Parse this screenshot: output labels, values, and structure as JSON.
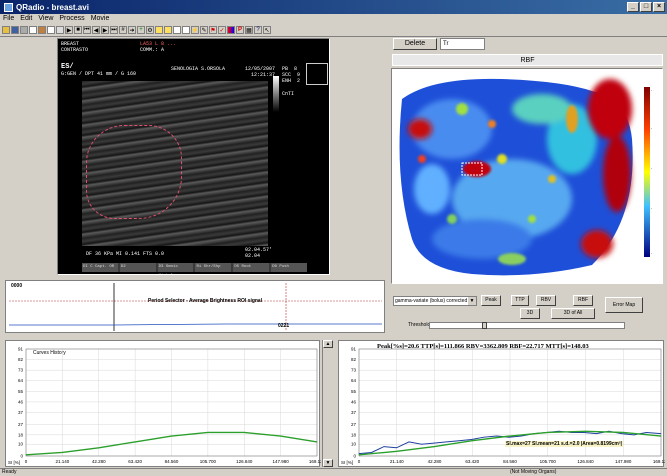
{
  "window": {
    "title": "QRadio - breast.avi"
  },
  "menu": [
    "File",
    "Edit",
    "View",
    "Process",
    "Movie"
  ],
  "ultrasound": {
    "top_left": [
      "BREAST",
      "CONTRASTO"
    ],
    "top_center": "LA53 L 8 ...",
    "comm": "COMM.: A",
    "es_label": "ES/",
    "gain_line": "G:GEN / DPT 41 mm / G 160",
    "hospital": "SENOLOGIA S.ORSOLA",
    "date": "12/05/2007",
    "time": "12:21:37",
    "params": [
      "PB  8",
      "SCC  9",
      "ENH  2"
    ],
    "cnti": "CnTI",
    "bottom_line": "DF 36 KPa MI 0.141 FTS 0.0",
    "timestamp": "02.04.57'",
    "frame": "02.04",
    "buttons": [
      "DI C Capt. OR",
      "D2",
      "D3 Omnic Histol.",
      "Ri Shr/Shp",
      "D5 Root",
      "D6 Push"
    ]
  },
  "rbf": {
    "delete_label": "Delete",
    "field_value": "Tr",
    "map_label": "RBF"
  },
  "period": {
    "counter_top": "0000",
    "title": "Period Selector - Average Brightness ROI signal",
    "counter_bottom": "0221"
  },
  "controls": {
    "method": "gamma-variate (bolus) corrected",
    "buttons": {
      "peak": "Peak",
      "ttp": "TTP",
      "rbv": "RBV",
      "rbf": "RBF",
      "d3": "3D",
      "d3all": "3D of All",
      "errmap": "Error Map"
    },
    "threshold": "Threshold",
    "threshold_fraction": 0.28
  },
  "left_chart": {
    "title": "Curves History"
  },
  "right_chart": {
    "title": "Peak[%s]=20.6  TTP[s]=111.866  RBV=3362.809  RBF=22.717  MTT[s]=148.03",
    "stats": "Sl.max=27  Sl.mean=21  s.d.=2.0  |Area=0.8199cm²|"
  },
  "chart_data": [
    {
      "type": "line",
      "title": "Curves History",
      "ylabel": "SI [%]",
      "ylim": [
        0,
        91
      ],
      "xlim": [
        0,
        169.12
      ],
      "yticks": [
        91,
        82,
        73,
        64,
        55,
        46,
        37,
        27,
        18,
        10,
        0
      ],
      "xticks": [
        "0",
        "21.140",
        "42.280",
        "63.420",
        "84.560",
        "105.700",
        "126.840",
        "147.980",
        "169.120"
      ],
      "series": [
        {
          "color": "#2ca02c",
          "x": [
            0,
            21.14,
            42.28,
            63.42,
            84.56,
            105.7,
            126.84,
            147.98,
            169.12
          ],
          "y": [
            1,
            3,
            7,
            12,
            17,
            20,
            20,
            17,
            12
          ]
        }
      ]
    },
    {
      "type": "line",
      "ylabel": "SI [%]",
      "ylim": [
        0,
        91
      ],
      "xlim": [
        0,
        169.12
      ],
      "yticks": [
        91,
        82,
        73,
        64,
        55,
        46,
        37,
        27,
        18,
        10,
        0
      ],
      "xticks": [
        "0",
        "21.140",
        "42.280",
        "63.420",
        "84.560",
        "105.700",
        "126.840",
        "147.980",
        "169.120"
      ],
      "series": [
        {
          "color": "#1f3f9f",
          "x": [
            0,
            7,
            14,
            21,
            28,
            35,
            42,
            49,
            56,
            63,
            70,
            77,
            84,
            91,
            98,
            105,
            112,
            119,
            126,
            133,
            140,
            147,
            154,
            161,
            169
          ],
          "y": [
            2,
            3,
            8,
            7,
            12,
            10,
            11,
            12,
            13,
            14,
            16,
            17,
            16,
            17,
            19,
            20,
            21,
            20,
            20,
            19,
            21,
            19,
            18,
            20,
            19
          ]
        },
        {
          "color": "#2ca02c",
          "x": [
            0,
            21.14,
            42.28,
            63.42,
            84.56,
            105.7,
            126.84,
            147.98,
            169.12
          ],
          "y": [
            1,
            4,
            8,
            13,
            17,
            20,
            21,
            20,
            17
          ]
        }
      ]
    }
  ],
  "status": {
    "left": "Ready",
    "right": "(Not Moving Organs)"
  }
}
